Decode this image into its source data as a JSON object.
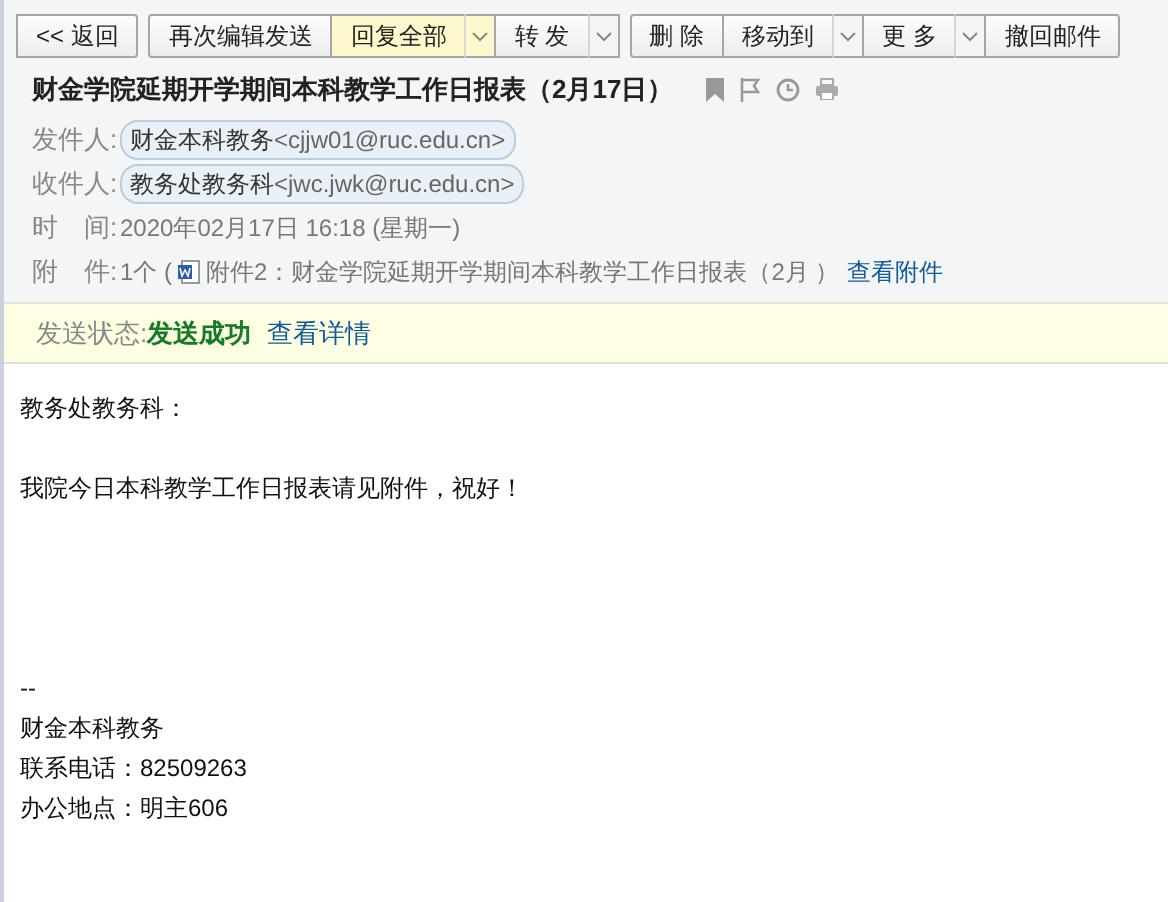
{
  "toolbar": [
    [
      {
        "label": "<< 返回",
        "highlighted": false,
        "dropdown": false
      }
    ],
    [
      {
        "label": "再次编辑发送",
        "highlighted": false,
        "dropdown": false
      },
      {
        "label": "回复全部",
        "highlighted": true,
        "dropdown": true
      },
      {
        "label": "转 发",
        "highlighted": false,
        "dropdown": true
      }
    ],
    [
      {
        "label": "删 除",
        "highlighted": false,
        "dropdown": false
      },
      {
        "label": "移动到",
        "highlighted": false,
        "dropdown": true
      },
      {
        "label": "更 多",
        "highlighted": false,
        "dropdown": true
      },
      {
        "label": "撤回邮件",
        "highlighted": false,
        "dropdown": false
      }
    ]
  ],
  "subject": "财金学院延期开学期间本科教学工作日报表（2月17日）",
  "header": [
    {
      "kind": "contact",
      "label": "发件人:",
      "name": "财金本科教务",
      "address": "<cjjw01@ruc.edu.cn>"
    },
    {
      "kind": "contact",
      "label": "收件人:",
      "name": "教务处教务科",
      "address": "<jwc.jwk@ruc.edu.cn>"
    },
    {
      "kind": "text",
      "label": "时　间:",
      "value": "2020年02月17日 16:18 (星期一)"
    },
    {
      "kind": "attachment",
      "label": "附　件:",
      "value": "1个 (",
      "file": "附件2：财金学院延期开学期间本科教学工作日报表（2月 ）",
      "link": "查看附件"
    }
  ],
  "send_status": {
    "label": "发送状态:",
    "value": "发送成功",
    "link": "查看详情"
  },
  "body": {
    "greeting": "教务处教务科：",
    "message": "我院今日本科教学工作日报表请见附件，祝好！",
    "signature": [
      "--",
      "财金本科教务",
      "联系电话：82509263",
      "办公地点：明主606"
    ]
  }
}
